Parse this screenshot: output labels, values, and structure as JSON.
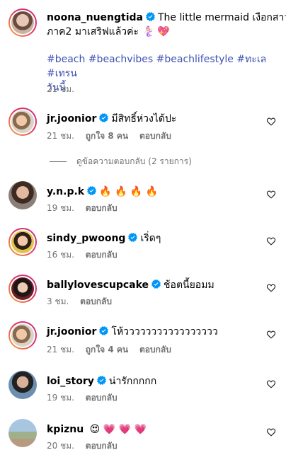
{
  "caption": {
    "username": "noona_nuengtida",
    "text_line1": "The little mermaid เงือกสาว",
    "text_line2": "ภาค2 มาเสริฟแล้วค่ะ 🧜🏻‍♀️ 💖",
    "hashtags_line1": "#beach #beachvibes #beachlifestyle #ทะเล #เทรน",
    "hashtags_line2": "วันนี้",
    "time": "21 ชม."
  },
  "view_replies": "ดูข้อความตอบกลับ (2 รายการ)",
  "comments": [
    {
      "username": "jr.joonior",
      "text": "มีสิทธิ์ห่วงได้ปะ",
      "time": "21 ชม.",
      "likes": "ถูกใจ 8 คน",
      "reply": "ตอบกลับ"
    },
    {
      "username": "y.n.p.k",
      "text": "🔥 🔥 🔥 🔥",
      "time": "19 ชม.",
      "likes": "",
      "reply": "ตอบกลับ"
    },
    {
      "username": "sindy_pwoong",
      "text": "เริ่ดๆ",
      "time": "16 ชม.",
      "likes": "",
      "reply": "ตอบกลับ"
    },
    {
      "username": "ballylovescupcake",
      "text": "ช้อตนี้ยอมม",
      "time": "3 ชม.",
      "likes": "",
      "reply": "ตอบกลับ"
    },
    {
      "username": "jr.joonior",
      "text": "โห้ววววววววววววววววว",
      "time": "21 ชม.",
      "likes": "ถูกใจ 4 คน",
      "reply": "ตอบกลับ"
    },
    {
      "username": "loi_story",
      "text": "น่ารักกกกก",
      "time": "19 ชม.",
      "likes": "",
      "reply": "ตอบกลับ"
    },
    {
      "username": "kpiznu",
      "text": "😍 💗 💗 💗",
      "time": "20 ชม.",
      "likes": "",
      "reply": "ตอบกลับ"
    }
  ],
  "colors": {
    "verified": "#0095f6",
    "hashtag": "#3f51b5",
    "meta": "#737373"
  }
}
